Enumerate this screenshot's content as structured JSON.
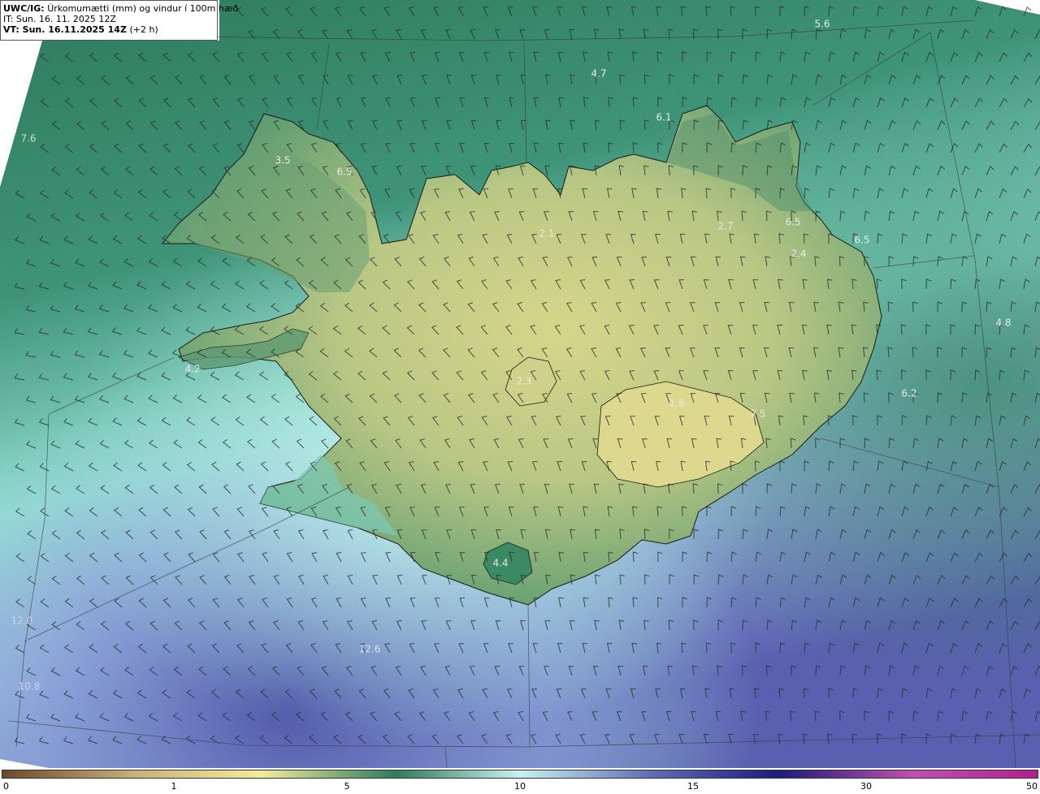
{
  "header": {
    "model_tag": "UWC/IG:",
    "title": "Úrkomumætti (mm) og vindur í 100m hæð",
    "issue_time": "IT: Sun. 16. 11. 2025 12Z",
    "valid_prefix": "VT: Sun. 16.11.2025 14Z",
    "valid_suffix": "(+2 h)"
  },
  "colorbar": {
    "ticks": [
      "0",
      "1",
      "5",
      "10",
      "15",
      "30",
      "50"
    ],
    "colors": [
      "#6b4a2a",
      "#c9b27a",
      "#f2ec9a",
      "#2e7a5a",
      "#c8f2f0",
      "#5e6ab6",
      "#1b1b7a",
      "#c050b0",
      "#b02090"
    ]
  },
  "map_values": [
    {
      "text": "5.6",
      "color": "#e8e8e8"
    },
    {
      "text": "4.7",
      "color": "#e8e8e8"
    },
    {
      "text": "6.1",
      "color": "#e8e8e8"
    },
    {
      "text": "7.6",
      "color": "#d8d8d8"
    },
    {
      "text": "3.5",
      "color": "#e8e8e8"
    },
    {
      "text": "6.5",
      "color": "#e8e8e8"
    },
    {
      "text": "2.1",
      "color": "#e8e8e8"
    },
    {
      "text": "2.7",
      "color": "#e8e8e8"
    },
    {
      "text": "6.5",
      "color": "#e8e8e8"
    },
    {
      "text": "6.5",
      "color": "#e8e8e8"
    },
    {
      "text": "2.4",
      "color": "#e8e8e8"
    },
    {
      "text": "4.8",
      "color": "#e8e8e8"
    },
    {
      "text": "4.2",
      "color": "#e8e8e8"
    },
    {
      "text": "2.3",
      "color": "#e8e8e8"
    },
    {
      "text": "1.8",
      "color": "#e8e8e8"
    },
    {
      "text": "2.5",
      "color": "#e8e8e8"
    },
    {
      "text": "6.2",
      "color": "#e8e8e8"
    },
    {
      "text": "4.4",
      "color": "#e8e8e8"
    },
    {
      "text": "12.0",
      "color": "#cfcfe8"
    },
    {
      "text": "12.6",
      "color": "#e0e0f0"
    },
    {
      "text": "10.8",
      "color": "#cfcfe8"
    }
  ]
}
